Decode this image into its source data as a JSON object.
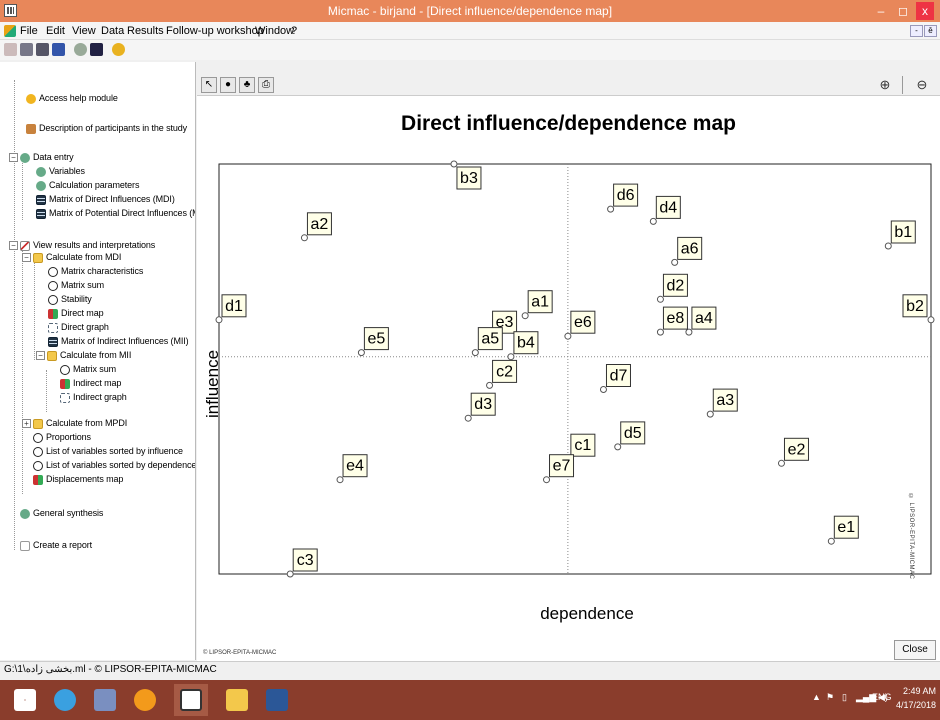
{
  "window": {
    "title": "Micmac  -  birjand - [Direct influence/dependence map]",
    "controls": {
      "minimize": "–",
      "maximize": "◻",
      "close": "x"
    }
  },
  "menu": {
    "items": [
      "File",
      "Edit",
      "View",
      "Data",
      "Results",
      "Follow-up workshop",
      "Window",
      "?"
    ],
    "mdi_min": "-",
    "mdi_restore": "ē"
  },
  "toolbar": {
    "icons": [
      "pencil-icon",
      "folder-icon",
      "print-icon",
      "save-icon",
      "settings-icon",
      "grid-icon",
      "help-icon"
    ]
  },
  "tree": {
    "access_help": "Access help module",
    "participants": "Description of participants in the study",
    "data_entry": "Data entry",
    "variables": "Variables",
    "calc_params": "Calculation parameters",
    "mdi": "Matrix of Direct Influences (MDI)",
    "mpdi": "Matrix of Potential Direct Influences (MPDI)",
    "view_results": "View results and interpretations",
    "calc_mdi": "Calculate from MDI",
    "matrix_chars": "Matrix characteristics",
    "matrix_sum": "Matrix sum",
    "stability": "Stability",
    "direct_map": "Direct map",
    "direct_graph": "Direct graph",
    "mii": "Matrix of Indirect Influences (MII)",
    "calc_mii": "Calculate from MII",
    "mii_matrix_sum": "Matrix sum",
    "indirect_map": "Indirect map",
    "indirect_graph": "Indirect graph",
    "calc_mpdi": "Calculate from MPDI",
    "proportions": "Proportions",
    "sorted_influence": "List of variables sorted by influence",
    "sorted_dependence": "List of variables sorted by dependence",
    "displacements": "Displacements map",
    "general_synthesis": "General synthesis",
    "create_report": "Create a report"
  },
  "statusbar": {
    "text": "G:\\1\\بخشی زاده.ml - © LIPSOR-EPITA-MICMAC"
  },
  "map": {
    "zoom_in": "⊕",
    "zoom_out": "⊖",
    "watermark_vertical": "© LIPSOR-EPITA-MICMAC",
    "watermark_bottom": "© LIPSOR-EPITA-MICMAC",
    "close_label": "Close"
  },
  "taskbar": {
    "lang": "ENG",
    "time": "2:49 AM",
    "date": "4/17/2018"
  },
  "chart_data": {
    "type": "scatter",
    "title": "Direct influence/dependence map",
    "xlabel": "dependence",
    "ylabel": "influence",
    "xlim": [
      0,
      100
    ],
    "ylim": [
      0,
      100
    ],
    "axis_cross": {
      "x": 49,
      "y": 53
    },
    "grid": false,
    "ticks": false,
    "points": [
      {
        "label": "b3",
        "x": 33,
        "y": 100
      },
      {
        "label": "a2",
        "x": 12,
        "y": 82
      },
      {
        "label": "d6",
        "x": 55,
        "y": 89
      },
      {
        "label": "d4",
        "x": 61,
        "y": 86
      },
      {
        "label": "b1",
        "x": 94,
        "y": 80
      },
      {
        "label": "a6",
        "x": 64,
        "y": 76
      },
      {
        "label": "d1",
        "x": 0,
        "y": 62
      },
      {
        "label": "a1",
        "x": 43,
        "y": 63
      },
      {
        "label": "d2",
        "x": 62,
        "y": 67
      },
      {
        "label": "a4",
        "x": 66,
        "y": 59
      },
      {
        "label": "e3",
        "x": 38,
        "y": 58
      },
      {
        "label": "e6",
        "x": 49,
        "y": 58
      },
      {
        "label": "e8",
        "x": 62,
        "y": 59
      },
      {
        "label": "b2",
        "x": 100,
        "y": 62
      },
      {
        "label": "e5",
        "x": 20,
        "y": 54
      },
      {
        "label": "a5",
        "x": 36,
        "y": 54
      },
      {
        "label": "c2",
        "x": 38,
        "y": 46
      },
      {
        "label": "b4",
        "x": 41,
        "y": 53
      },
      {
        "label": "d7",
        "x": 54,
        "y": 45
      },
      {
        "label": "a3",
        "x": 69,
        "y": 39
      },
      {
        "label": "d3",
        "x": 35,
        "y": 38
      },
      {
        "label": "c1",
        "x": 49,
        "y": 28
      },
      {
        "label": "d5",
        "x": 56,
        "y": 31
      },
      {
        "label": "e2",
        "x": 79,
        "y": 27
      },
      {
        "label": "e4",
        "x": 17,
        "y": 23
      },
      {
        "label": "e7",
        "x": 46,
        "y": 23
      },
      {
        "label": "e1",
        "x": 86,
        "y": 8
      },
      {
        "label": "c3",
        "x": 10,
        "y": 0
      }
    ]
  }
}
